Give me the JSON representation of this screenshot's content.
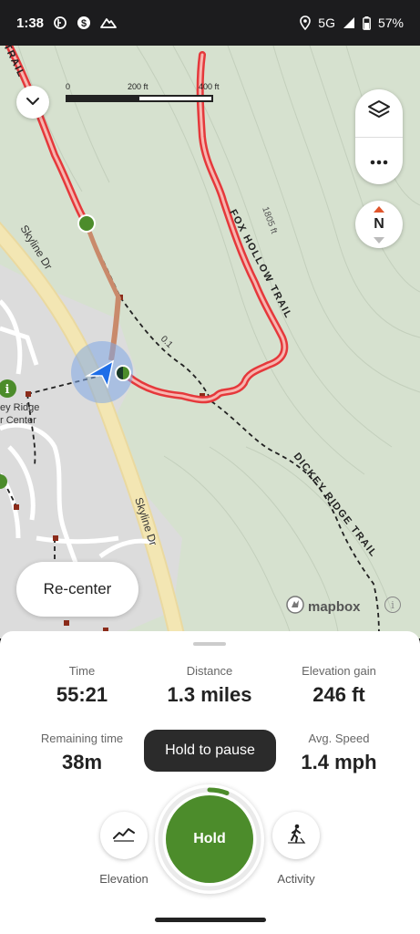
{
  "status_bar": {
    "time": "1:38",
    "network": "5G",
    "battery": "57%"
  },
  "map": {
    "scale": {
      "zero": "0",
      "mid": "200 ft",
      "max": "400 ft"
    },
    "labels": {
      "fox_hollow_trail": "FOX HOLLOW TRAIL",
      "dickey_ridge_trail": "DICKEY RIDGE TRAIL",
      "skyline_dr_upper": "Skyline Dr",
      "skyline_dr_lower": "Skyline Dr",
      "elevation_contour": "1805 ft",
      "segment_distance": "0.1",
      "visitor_center_line1": "ey Ridge",
      "visitor_center_line2": "r Center",
      "trail_top_left": "TRAIL",
      "compass": "N",
      "attribution": "mapbox"
    },
    "recenter_label": "Re-center"
  },
  "stats": {
    "time": {
      "label": "Time",
      "value": "55:21"
    },
    "distance": {
      "label": "Distance",
      "value": "1.3 miles"
    },
    "elevation_gain": {
      "label": "Elevation gain",
      "value": "246 ft"
    },
    "remaining_time": {
      "label": "Remaining time",
      "value": "38m"
    },
    "avg_speed": {
      "label": "Avg. Speed",
      "value": "1.4 mph"
    }
  },
  "controls": {
    "tooltip": "Hold to pause",
    "hold_label": "Hold",
    "elevation_label": "Elevation",
    "activity_label": "Activity"
  },
  "colors": {
    "accent_green": "#4c8c2b",
    "trail_red": "#e5383b",
    "location_blue": "#1e6ee8"
  }
}
